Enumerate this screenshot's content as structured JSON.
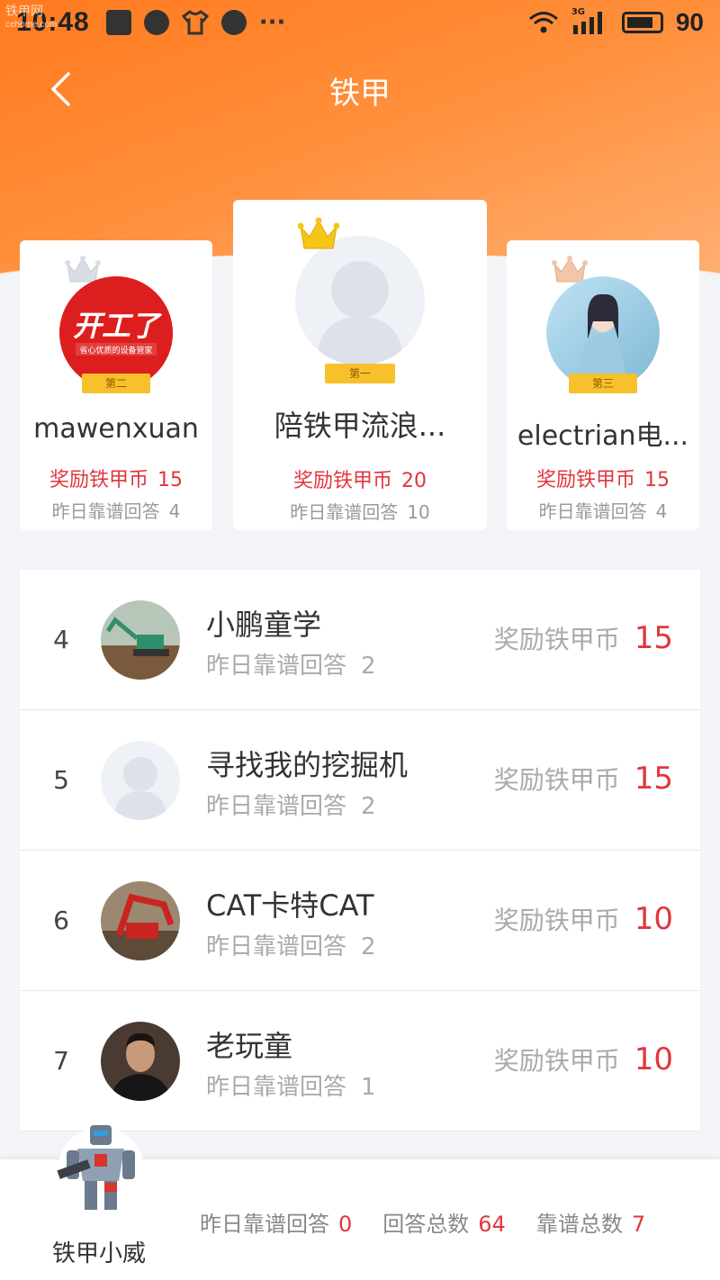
{
  "status_bar": {
    "time": "10:48",
    "network": "3G",
    "battery": "90",
    "watermark_line1": "铁甲网",
    "watermark_line2": "cehome.com"
  },
  "nav": {
    "title": "铁甲"
  },
  "podium": {
    "first": {
      "rank_label": "第一",
      "name": "陪铁甲流浪...",
      "reward_label": "奖励铁甲币",
      "reward": "20",
      "answers_label": "昨日靠谱回答",
      "answers": "10"
    },
    "second": {
      "rank_label": "第二",
      "name": "mawenxuan",
      "reward_label": "奖励铁甲币",
      "reward": "15",
      "answers_label": "昨日靠谱回答",
      "answers": "4",
      "avatar_logo_main": "开工了",
      "avatar_logo_sub": "省心优质的设备管家"
    },
    "third": {
      "rank_label": "第三",
      "name": "electrian电...",
      "reward_label": "奖励铁甲币",
      "reward": "15",
      "answers_label": "昨日靠谱回答",
      "answers": "4"
    }
  },
  "list": [
    {
      "rank": "4",
      "name": "小鹏童学",
      "answers_label": "昨日靠谱回答",
      "answers": "2",
      "reward_label": "奖励铁甲币",
      "reward": "15"
    },
    {
      "rank": "5",
      "name": "寻找我的挖掘机",
      "answers_label": "昨日靠谱回答",
      "answers": "2",
      "reward_label": "奖励铁甲币",
      "reward": "15"
    },
    {
      "rank": "6",
      "name": "CAT卡特CAT",
      "answers_label": "昨日靠谱回答",
      "answers": "2",
      "reward_label": "奖励铁甲币",
      "reward": "10"
    },
    {
      "rank": "7",
      "name": "老玩童",
      "answers_label": "昨日靠谱回答",
      "answers": "1",
      "reward_label": "奖励铁甲币",
      "reward": "10"
    }
  ],
  "me": {
    "name": "铁甲小威",
    "yesterday_label": "昨日靠谱回答",
    "yesterday": "0",
    "total_label": "回答总数",
    "total": "64",
    "reliable_label": "靠谱总数",
    "reliable": "7"
  },
  "colors": {
    "accent": "#ff7a1f",
    "reward_red": "#e2363d",
    "gold": "#f7c12b"
  }
}
